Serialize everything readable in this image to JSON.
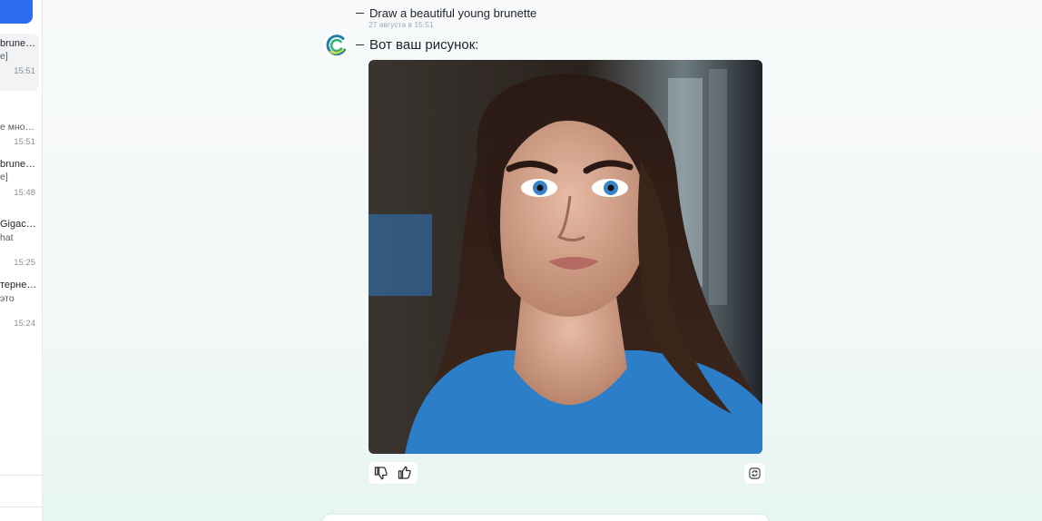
{
  "sidebar": {
    "chats": [
      {
        "title": "brune…",
        "subtitle": "e]",
        "time": "15:51"
      },
      {
        "title": "",
        "subtitle": "е мно…",
        "time": "15:51"
      },
      {
        "title": "brune…",
        "subtitle": "e]",
        "time": "15:48"
      },
      {
        "title": "Gigac…",
        "subtitle": "hat",
        "time": "15:25"
      },
      {
        "title": "терне…",
        "subtitle": "это",
        "time": "15:24"
      }
    ]
  },
  "conversation": {
    "user_message": "Draw a beautiful young brunette",
    "user_timestamp": "27 августа в 15:51",
    "bot_message": "Вот ваш рисунок:"
  },
  "icons": {
    "bot_avatar": "gigachat-logo-icon",
    "dislike": "thumbs-down-icon",
    "like": "thumbs-up-icon",
    "regenerate": "refresh-icon"
  },
  "colors": {
    "accent": "#2f6bf0",
    "logo_green": "#3bb273",
    "logo_teal": "#1f7fa6",
    "logo_yellow": "#c9d73a"
  }
}
